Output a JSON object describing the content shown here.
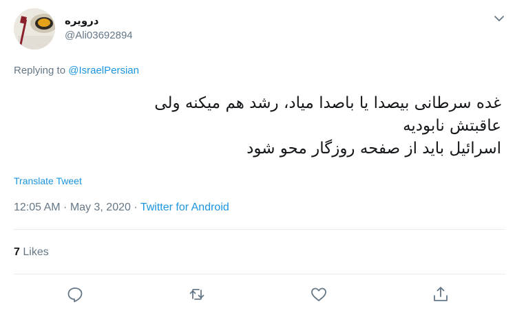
{
  "user": {
    "display_name": "درویره",
    "handle": "@Ali03692894"
  },
  "replying": {
    "prefix": "Replying to",
    "mention": "@IsraelPersian"
  },
  "tweet": {
    "lines": [
      "غده سرطانی بیصدا یا باصدا میاد، رشد هم میکنه ولی",
      "عاقبتش نابودیه",
      "اسرائیل باید از صفحه روزگار محو شود"
    ]
  },
  "translate_label": "Translate Tweet",
  "meta": {
    "time": "12:05 AM",
    "sep1": " · ",
    "date": "May 3, 2020",
    "sep2": " · ",
    "source": "Twitter for Android"
  },
  "stats": {
    "likes_count": "7",
    "likes_label": "Likes"
  },
  "icons": {
    "more": "chevron-down-icon",
    "reply": "reply-icon",
    "retweet": "retweet-icon",
    "like": "heart-icon",
    "share": "share-icon"
  },
  "colors": {
    "accent": "#1b95e0",
    "secondary_text": "#657786",
    "primary_text": "#14171a",
    "divider": "#e6ecf0"
  }
}
